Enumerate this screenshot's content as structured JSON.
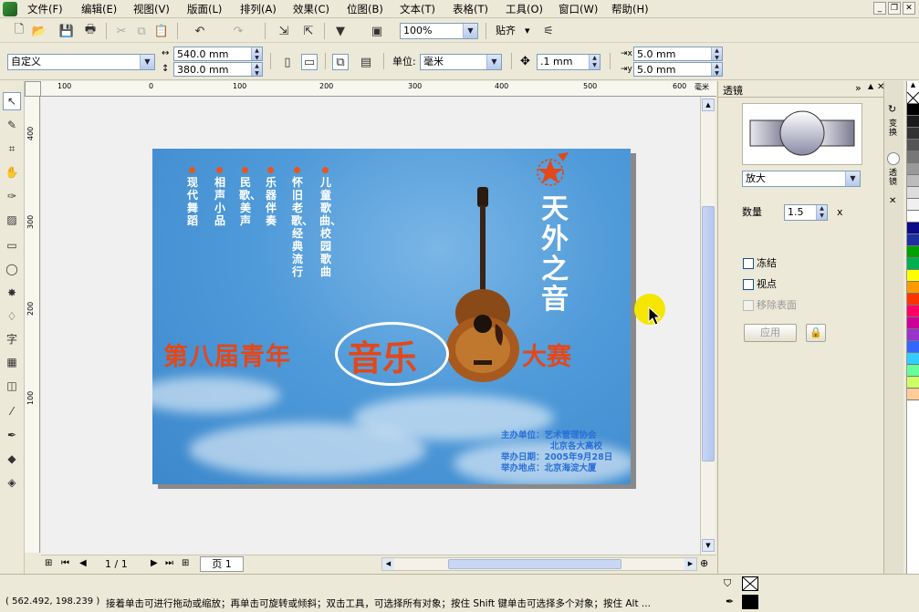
{
  "menu": {
    "items": [
      "文件(F)",
      "编辑(E)",
      "视图(V)",
      "版面(L)",
      "排列(A)",
      "效果(C)",
      "位图(B)",
      "文本(T)",
      "表格(T)",
      "工具(O)",
      "窗口(W)",
      "帮助(H)"
    ]
  },
  "toolbar": {
    "zoom_value": "100%",
    "snap_label": "贴齐"
  },
  "property_bar": {
    "page_size_preset": "自定义",
    "width": "540.0 mm",
    "height": "380.0 mm",
    "unit_label": "单位:",
    "unit_value": "毫米",
    "nudge": ".1 mm",
    "dup_x": "5.0 mm",
    "dup_y": "5.0 mm"
  },
  "ruler_h": [
    "100",
    "0",
    "100",
    "200",
    "300",
    "400",
    "500",
    "600",
    "毫米"
  ],
  "ruler_v": [
    "400",
    "300",
    "200",
    "100"
  ],
  "poster": {
    "columns": [
      "现代舞蹈",
      "相声小品",
      "民歌、美声",
      "乐器伴奏",
      "怀旧老歌、经典流行",
      "儿童歌曲、校园歌曲"
    ],
    "title_left": "第八届青年",
    "title_music": "音乐",
    "title_right": "大赛",
    "brand": "天外之音",
    "info": [
      "主办单位：艺术管理协会",
      "北京各大高校",
      "举办日期：2005年9月28日",
      "举办地点：北京海淀大厦"
    ]
  },
  "navigation": {
    "page_count": "1 / 1",
    "page_tab": "页 1"
  },
  "docker": {
    "title": "透镜",
    "lens_type": "放大",
    "amount_label": "数量",
    "amount_value": "1.5",
    "amount_suffix": "x",
    "freeze_label": "冻结",
    "viewpoint_label": "视点",
    "remove_face_label": "移除表面",
    "apply_label": "应用",
    "side_tab_1": "变换",
    "side_tab_2": "透镜"
  },
  "status": {
    "coordinates": "( 562.492, 198.239 )",
    "hint": "接着单击可进行拖动或缩放；再单击可旋转或倾斜；双击工具，可选择所有对象；按住 Shift 键单击可选择多个对象；按住 Alt ..."
  },
  "colors": {
    "accent_orange": "#e2481a",
    "info_blue": "#2a6fd6",
    "sky_blue": "#4f9ad9"
  }
}
